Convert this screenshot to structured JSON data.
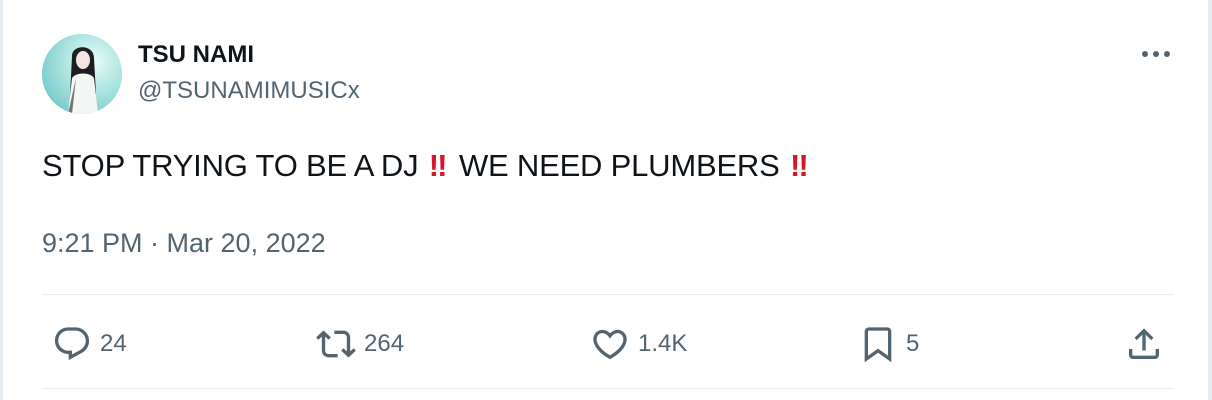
{
  "author": {
    "display_name": "TSU NAMI",
    "handle": "@TSUNAMIMUSICx"
  },
  "tweet": {
    "text_part1": "STOP TRYING TO BE A DJ",
    "emphasis_1": "‼",
    "text_part2": "WE NEED PLUMBERS",
    "emphasis_2": "‼",
    "timestamp": "9:21 PM · Mar 20, 2022"
  },
  "actions": {
    "reply": {
      "icon": "reply-bubble-icon",
      "count": "24"
    },
    "retweet": {
      "icon": "retweet-icon",
      "count": "264"
    },
    "like": {
      "icon": "heart-icon",
      "count": "1.4K"
    },
    "bookmark": {
      "icon": "bookmark-icon",
      "count": "5"
    },
    "share": {
      "icon": "share-upload-icon"
    }
  },
  "colors": {
    "text_primary": "#0f1419",
    "text_secondary": "#536471",
    "emphasis_red": "#d9152b",
    "divider": "#e7ecf0"
  }
}
